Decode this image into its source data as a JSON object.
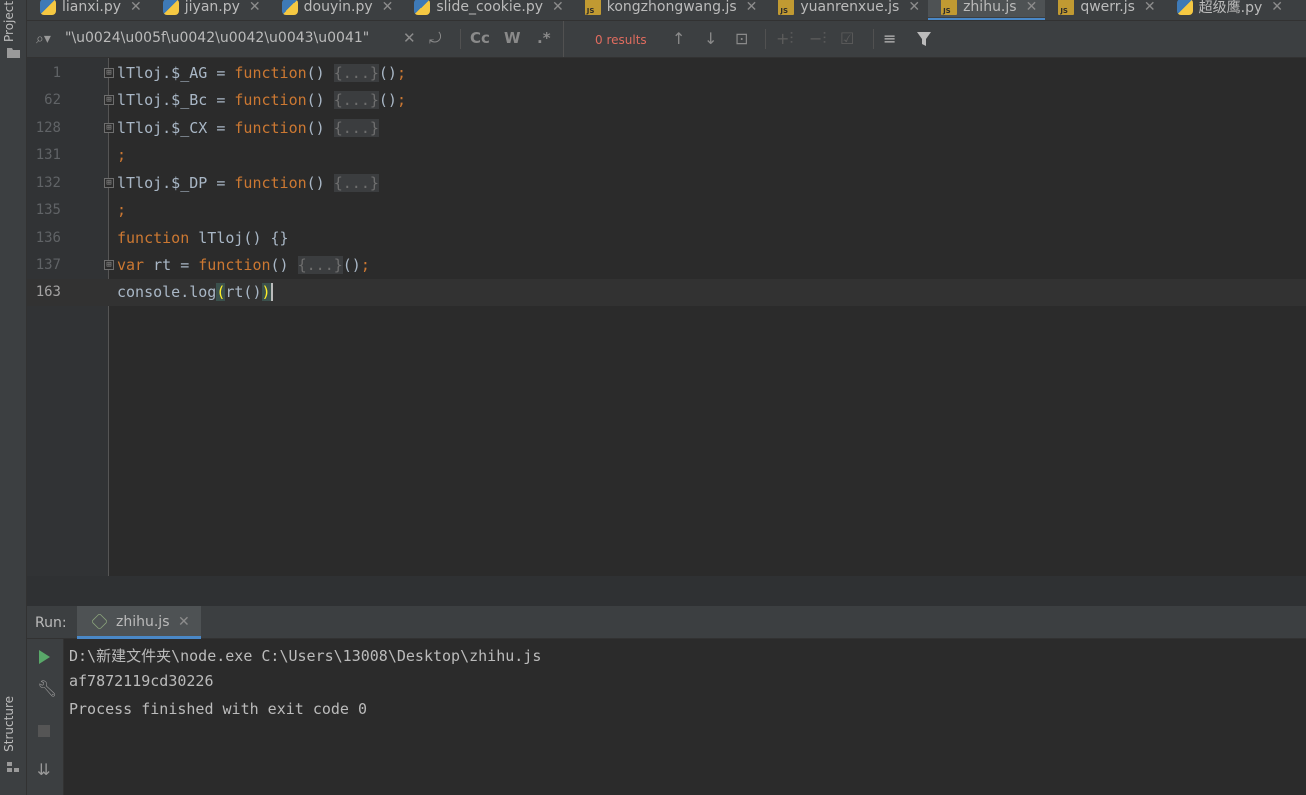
{
  "tool_windows": {
    "project_label": "Project",
    "structure_label": "Structure"
  },
  "tabs": [
    {
      "label": "lianxi.py",
      "type": "py",
      "active": false
    },
    {
      "label": "jiyan.py",
      "type": "py",
      "active": false
    },
    {
      "label": "douyin.py",
      "type": "py",
      "active": false
    },
    {
      "label": "slide_cookie.py",
      "type": "py",
      "active": false
    },
    {
      "label": "kongzhongwang.js",
      "type": "js",
      "active": false
    },
    {
      "label": "yuanrenxue.js",
      "type": "js",
      "active": false
    },
    {
      "label": "zhihu.js",
      "type": "js",
      "active": true
    },
    {
      "label": "qwerr.js",
      "type": "js",
      "active": false
    },
    {
      "label": "超级鹰.py",
      "type": "py",
      "active": false
    }
  ],
  "search": {
    "query": "\"\\u0024\\u005f\\u0042\\u0042\\u0043\\u0041\"",
    "results": "0 results",
    "match_case": "Cc",
    "words": "W",
    "regex": ".*"
  },
  "editor": {
    "lines": [
      {
        "num": "1",
        "fold": true
      },
      {
        "num": "62",
        "fold": true
      },
      {
        "num": "128",
        "fold": true
      },
      {
        "num": "131",
        "fold": false
      },
      {
        "num": "132",
        "fold": true
      },
      {
        "num": "135",
        "fold": false
      },
      {
        "num": "136",
        "fold": false
      },
      {
        "num": "137",
        "fold": true
      },
      {
        "num": "163",
        "fold": false
      }
    ],
    "code": {
      "l1_a": "lTloj.$_AG = ",
      "l1_kw": "function",
      "l1_b": "() ",
      "l1_fold": "{...}",
      "l1_c": "()",
      "l1_semi": ";",
      "l2_a": "lTloj.$_Bc = ",
      "l2_kw": "function",
      "l2_b": "() ",
      "l2_fold": "{...}",
      "l2_c": "()",
      "l2_semi": ";",
      "l3_a": "lTloj.$_CX = ",
      "l3_kw": "function",
      "l3_b": "() ",
      "l3_fold": "{...}",
      "l4_semi": ";",
      "l5_a": "lTloj.$_DP = ",
      "l5_kw": "function",
      "l5_b": "() ",
      "l5_fold": "{...}",
      "l6_semi": ";",
      "l7_kw": "function",
      "l7_b": " lTloj() {}",
      "l8_kw1": "var",
      "l8_a": " rt = ",
      "l8_kw2": "function",
      "l8_b": "() ",
      "l8_fold": "{...}",
      "l8_c": "()",
      "l8_semi": ";",
      "l9_a": "console.log",
      "l9_p1": "(",
      "l9_b": "rt()",
      "l9_p2": ")"
    }
  },
  "run": {
    "label": "Run:",
    "tab_name": "zhihu.js",
    "output": [
      "D:\\新建文件夹\\node.exe C:\\Users\\13008\\Desktop\\zhihu.js",
      "af7872119cd30226",
      "Process finished with exit code 0"
    ]
  },
  "colors": {
    "keyword": "#cc7832",
    "text": "#a9b7c6",
    "results_error": "#e06c5f",
    "run_play": "#59a869",
    "tab_accent": "#4a88c7"
  }
}
